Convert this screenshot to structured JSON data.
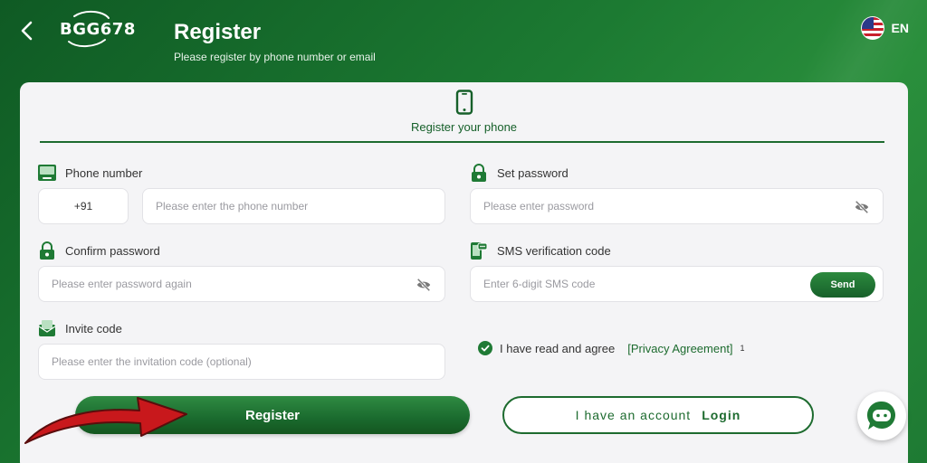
{
  "header": {
    "logo_text": "BGG678",
    "title": "Register",
    "subtitle": "Please register by phone number or email",
    "language": "EN",
    "language_flag": "us-flag-icon"
  },
  "tab": {
    "label": "Register your phone",
    "icon": "phone-icon"
  },
  "fields": {
    "phone": {
      "label": "Phone number",
      "country_code": "+91",
      "placeholder": "Please enter the phone number",
      "icon": "phone-card-icon"
    },
    "set_password": {
      "label": "Set password",
      "placeholder": "Please enter password",
      "icon": "lock-icon"
    },
    "confirm_password": {
      "label": "Confirm password",
      "placeholder": "Please enter password again",
      "icon": "lock-icon"
    },
    "sms_code": {
      "label": "SMS verification code",
      "placeholder": "Enter 6-digit SMS code",
      "send_label": "Send",
      "icon": "sms-phone-icon"
    },
    "invite_code": {
      "label": "Invite code",
      "placeholder": "Please enter the invitation code (optional)",
      "icon": "invite-icon"
    }
  },
  "agreement": {
    "text": "I have read and agree",
    "link": "[Privacy Agreement]",
    "superscript": "1",
    "checked": true
  },
  "actions": {
    "register_label": "Register",
    "login_prefix": "I have an account",
    "login_label": "Login"
  },
  "colors": {
    "brand_green": "#1d6b2f",
    "background_green": "#1c7a32",
    "arrow_red": "#c8181c"
  }
}
